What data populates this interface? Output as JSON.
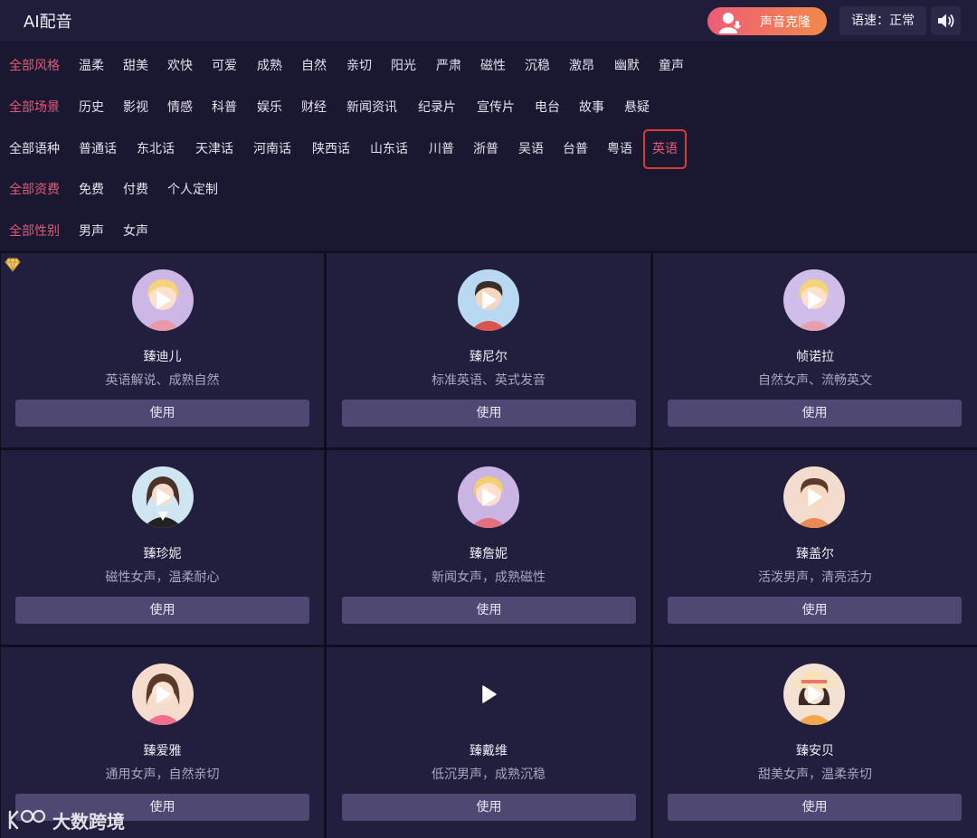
{
  "header": {
    "title": "AI配音",
    "clone_label": "声音克隆",
    "speed_label": "语速：正常",
    "volume_icon": "speaker-icon"
  },
  "filters": {
    "style": {
      "all": "全部风格",
      "items": [
        "温柔",
        "甜美",
        "欢快",
        "可爱",
        "成熟",
        "自然",
        "亲切",
        "阳光",
        "严肃",
        "磁性",
        "沉稳",
        "激昂",
        "幽默",
        "童声"
      ]
    },
    "scene": {
      "all": "全部场景",
      "items": [
        "历史",
        "影视",
        "情感",
        "科普",
        "娱乐",
        "财经",
        "新闻资讯",
        "纪录片",
        "宣传片",
        "电台",
        "故事",
        "悬疑"
      ]
    },
    "language": {
      "all": "全部语种",
      "items": [
        "普通话",
        "东北话",
        "天津话",
        "河南话",
        "陕西话",
        "山东话",
        "川普",
        "浙普",
        "吴语",
        "台普",
        "粤语",
        "英语"
      ],
      "selected": "英语"
    },
    "fee": {
      "all": "全部资费",
      "items": [
        "免费",
        "付费",
        "个人定制"
      ]
    },
    "gender": {
      "all": "全部性别",
      "items": [
        "男声",
        "女声"
      ]
    }
  },
  "cards": [
    {
      "name": "臻迪儿",
      "desc": "英语解说、成熟自然",
      "button": "使用",
      "avatar": "blonde-girl-avatar",
      "vip": true
    },
    {
      "name": "臻尼尔",
      "desc": "标准英语、英式发音",
      "button": "使用",
      "avatar": "boy-avatar"
    },
    {
      "name": "帧诺拉",
      "desc": "自然女声、流畅英文",
      "button": "使用",
      "avatar": "blonde-girl-avatar"
    },
    {
      "name": "臻珍妮",
      "desc": "磁性女声，温柔耐心",
      "button": "使用",
      "avatar": "brunette-woman-avatar"
    },
    {
      "name": "臻詹妮",
      "desc": "新闻女声，成熟磁性",
      "button": "使用",
      "avatar": "blonde-girl-avatar"
    },
    {
      "name": "臻盖尔",
      "desc": "活泼男声，清亮活力",
      "button": "使用",
      "avatar": "boy-avatar"
    },
    {
      "name": "臻爱雅",
      "desc": "通用女声，自然亲切",
      "button": "使用",
      "avatar": "pink-girl-avatar"
    },
    {
      "name": "臻戴维",
      "desc": "低沉男声，成熟沉稳",
      "button": "使用",
      "avatar": "none"
    },
    {
      "name": "臻安贝",
      "desc": "甜美女声，温柔亲切",
      "button": "使用",
      "avatar": "sunhat-girl-avatar"
    }
  ],
  "watermark": "大数跨境",
  "colors": {
    "accent": "#e35a7a",
    "background": "#1e1b38",
    "card": "#221f3e",
    "button": "#4e4873",
    "highlight_box": "#d83a3a"
  }
}
